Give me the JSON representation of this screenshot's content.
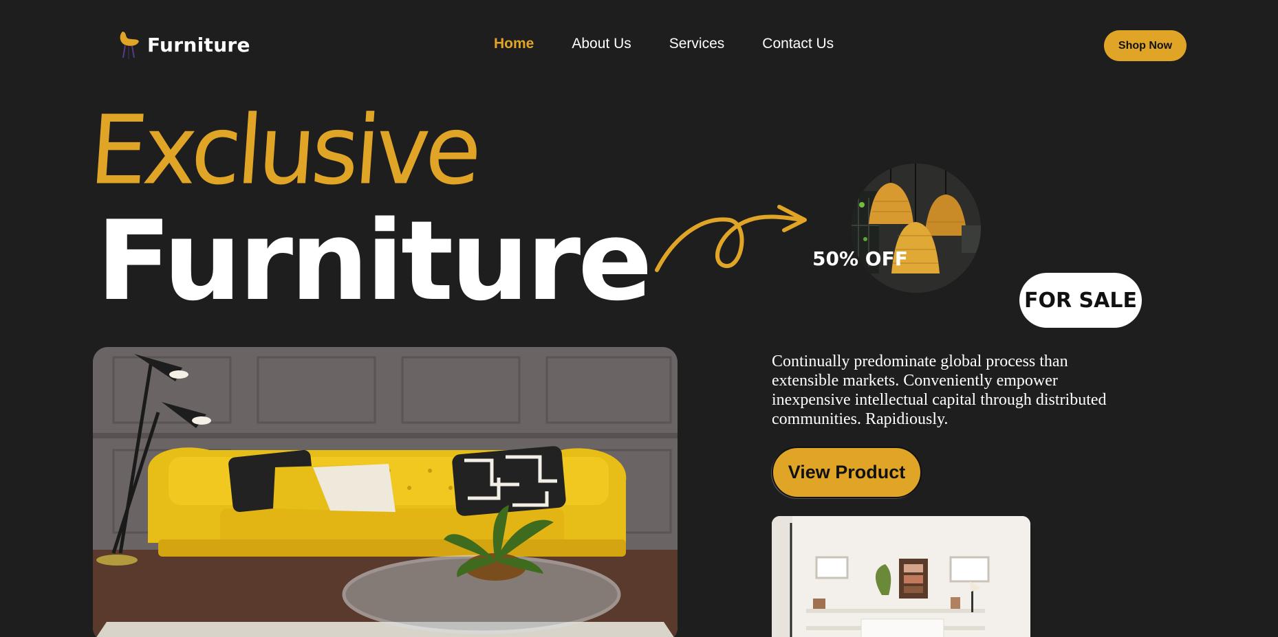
{
  "brand": {
    "name": "Furniture",
    "logo_icon": "chair-icon"
  },
  "nav": {
    "items": [
      {
        "label": "Home",
        "active": true
      },
      {
        "label": "About Us",
        "active": false
      },
      {
        "label": "Services",
        "active": false
      },
      {
        "label": "Contact Us",
        "active": false
      }
    ]
  },
  "header": {
    "cta_label": "Shop Now"
  },
  "hero": {
    "title_top": "Exclusive",
    "title_bottom": "Furniture",
    "discount": "50% OFF",
    "sale_badge": "FOR SALE",
    "description": "Continually predominate global process than extensible markets. Conveniently empower inexpensive intellectual capital through distributed communities. Rapidiously.",
    "cta_label": "View Product"
  },
  "colors": {
    "background": "#1e1e1e",
    "accent": "#e0a526",
    "text": "#ffffff"
  }
}
